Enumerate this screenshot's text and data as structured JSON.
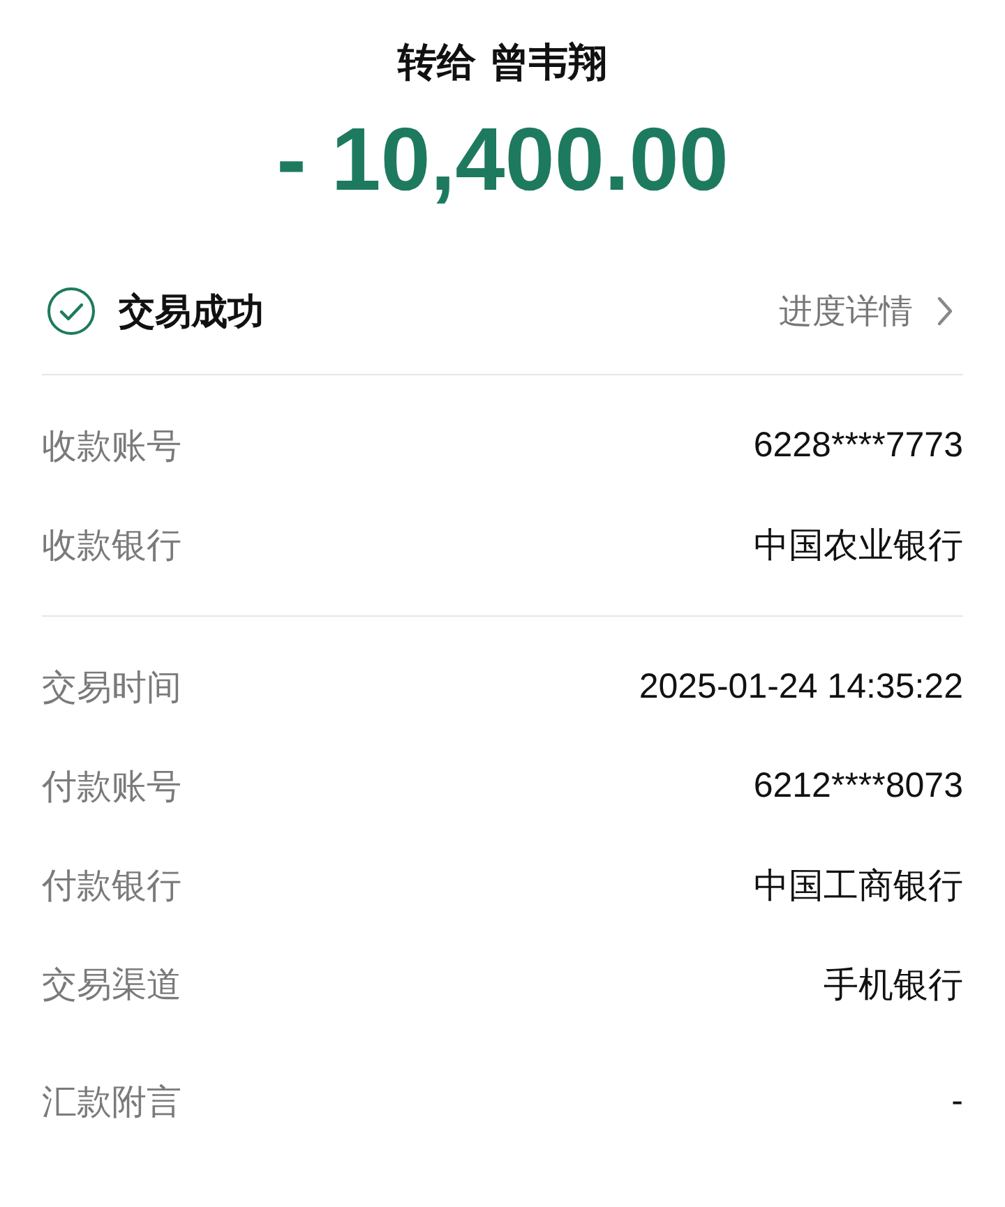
{
  "header": {
    "title": "转给 曾韦翔",
    "amount": "- 10,400.00"
  },
  "status": {
    "text": "交易成功",
    "link": "进度详情"
  },
  "sections": [
    {
      "rows": [
        {
          "label": "收款账号",
          "value": "6228****7773"
        },
        {
          "label": "收款银行",
          "value": "中国农业银行"
        }
      ]
    },
    {
      "rows": [
        {
          "label": "交易时间",
          "value": "2025-01-24 14:35:22"
        },
        {
          "label": "付款账号",
          "value": "6212****8073"
        },
        {
          "label": "付款银行",
          "value": "中国工商银行"
        },
        {
          "label": "交易渠道",
          "value": "手机银行"
        },
        {
          "label": "汇款附言",
          "value": "-"
        }
      ]
    }
  ]
}
